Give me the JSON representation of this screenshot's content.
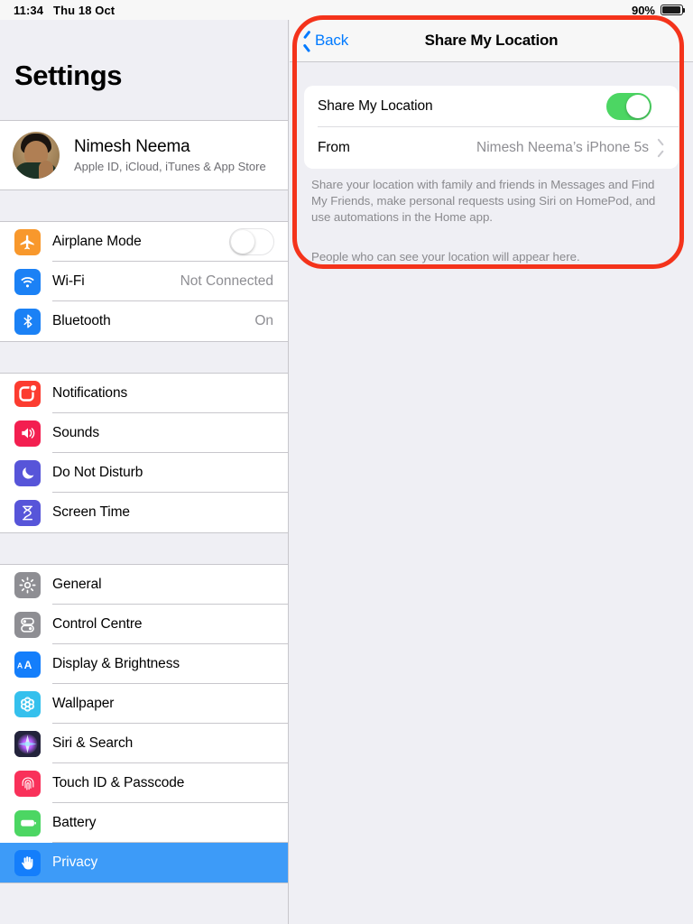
{
  "status_bar": {
    "time": "11:34",
    "date": "Thu 18 Oct",
    "battery_percent": "90%",
    "battery_icon": "battery-full-icon"
  },
  "sidebar": {
    "title": "Settings",
    "profile": {
      "name": "Nimesh Neema",
      "subtitle": "Apple ID, iCloud, iTunes & App Store",
      "avatar_icon": "user-avatar"
    },
    "groups": [
      {
        "items": [
          {
            "label": "Airplane Mode",
            "icon": "airplane-icon",
            "icon_color": "#f8982c",
            "control": "toggle",
            "toggle_on": false
          },
          {
            "label": "Wi-Fi",
            "icon": "wifi-icon",
            "icon_color": "#1b81f5",
            "control": "value",
            "value": "Not Connected"
          },
          {
            "label": "Bluetooth",
            "icon": "bluetooth-icon",
            "icon_color": "#1b81f5",
            "control": "value",
            "value": "On"
          }
        ]
      },
      {
        "items": [
          {
            "label": "Notifications",
            "icon": "notifications-icon",
            "icon_color": "#fc3c30",
            "control": "none"
          },
          {
            "label": "Sounds",
            "icon": "sounds-icon",
            "icon_color": "#f31f50",
            "control": "none"
          },
          {
            "label": "Do Not Disturb",
            "icon": "moon-icon",
            "icon_color": "#5755d9",
            "control": "none"
          },
          {
            "label": "Screen Time",
            "icon": "hourglass-icon",
            "icon_color": "#5755d9",
            "control": "none"
          }
        ]
      },
      {
        "items": [
          {
            "label": "General",
            "icon": "gear-icon",
            "icon_color": "#8e8e93",
            "control": "none"
          },
          {
            "label": "Control Centre",
            "icon": "control-centre-icon",
            "icon_color": "#8e8e93",
            "control": "none"
          },
          {
            "label": "Display & Brightness",
            "icon": "display-brightness-icon",
            "icon_color": "#147efb",
            "control": "none"
          },
          {
            "label": "Wallpaper",
            "icon": "wallpaper-icon",
            "icon_color": "#35c0ed",
            "control": "none"
          },
          {
            "label": "Siri & Search",
            "icon": "siri-icon",
            "icon_color": "#2b2b45",
            "control": "none"
          },
          {
            "label": "Touch ID & Passcode",
            "icon": "fingerprint-icon",
            "icon_color": "#f9315a",
            "control": "none"
          },
          {
            "label": "Battery",
            "icon": "battery-icon",
            "icon_color": "#4cd663",
            "control": "none"
          },
          {
            "label": "Privacy",
            "icon": "privacy-hand-icon",
            "icon_color": "#147efb",
            "control": "none",
            "selected": true
          }
        ]
      }
    ],
    "selected_item": "Privacy",
    "selection_color": "#3d9bf8"
  },
  "detail": {
    "nav": {
      "back_label": "Back",
      "back_icon": "chevron-left-icon",
      "title": "Share My Location",
      "accent_color": "#007aff"
    },
    "rows": [
      {
        "label": "Share My Location",
        "control": "toggle",
        "toggle_on": true,
        "toggle_color": "#4cd663"
      },
      {
        "label": "From",
        "control": "value",
        "value": "Nimesh Neema’s iPhone 5s",
        "chevron_icon": "chevron-right-icon"
      }
    ],
    "footnote_1": "Share your location with family and friends in Messages and Find My Friends, make personal requests using Siri on HomePod, and use automations in the Home app.",
    "footnote_2": "People who can see your location will appear here."
  },
  "annotation": {
    "shape": "rounded-rectangle-highlight",
    "color": "#f4331b"
  }
}
